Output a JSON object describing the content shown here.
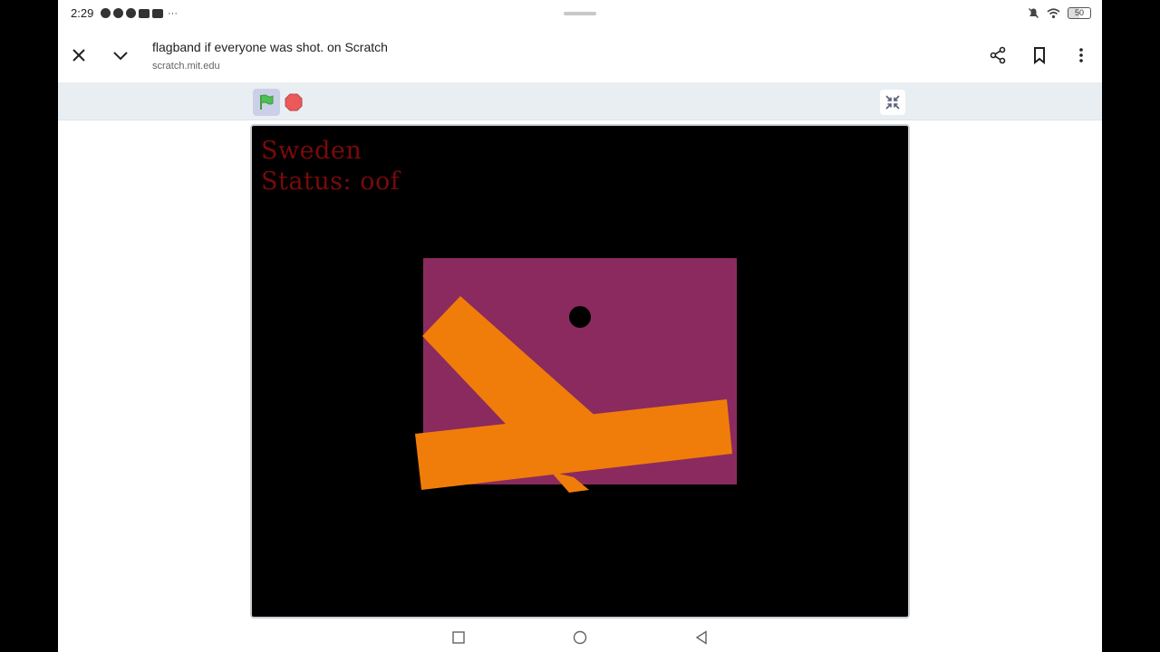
{
  "status_bar": {
    "time": "2:29",
    "app_icons": [
      "facebook-icon",
      "facebook-icon",
      "messenger-icon",
      "youtube-icon",
      "youtube-icon"
    ],
    "more": "···",
    "battery": "50"
  },
  "toolbar": {
    "title": "flagband if everyone was shot. on Scratch",
    "url": "scratch.mit.edu",
    "icons": [
      "close-icon",
      "chevron-down-icon",
      "share-icon",
      "bookmark-icon",
      "more-vert-icon"
    ]
  },
  "scratch_controls": {
    "icons": [
      "green-flag-icon",
      "stop-icon",
      "fullscreen-exit-icon"
    ]
  },
  "stage": {
    "country": "Sweden",
    "status": "Status: oof",
    "colors": {
      "background": "#000000",
      "flag_field": "#8b2a5e",
      "cross": "#f07d0a",
      "text": "#7a0a0a",
      "hole": "#000000"
    }
  },
  "nav_bar": {
    "icons": [
      "square-recents-icon",
      "circle-home-icon",
      "triangle-back-icon"
    ]
  }
}
